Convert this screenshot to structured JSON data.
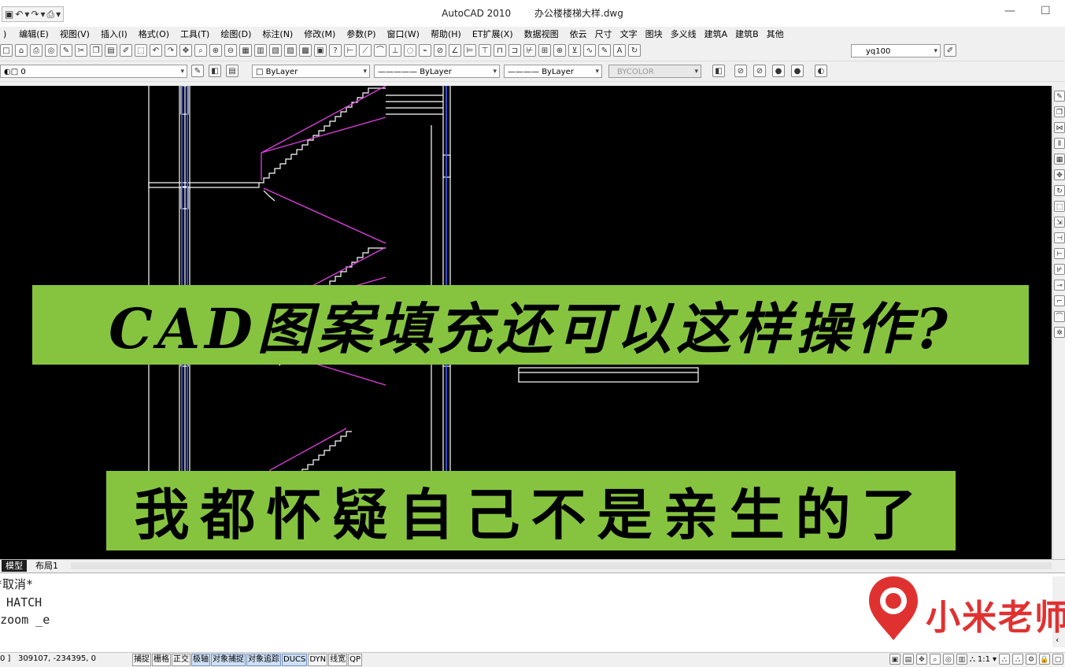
{
  "window": {
    "app_name": "AutoCAD 2010",
    "file_name": "办公楼楼梯大样.dwg"
  },
  "menu": [
    "编辑(E)",
    "视图(V)",
    "插入(I)",
    "格式(O)",
    "工具(T)",
    "绘图(D)",
    "标注(N)",
    "修改(M)",
    "参数(P)",
    "窗口(W)",
    "帮助(H)",
    "ET扩展(X)",
    "数据视图",
    "依云",
    "尺寸",
    "文字",
    "图块",
    "多义线",
    "建筑A",
    "建筑B",
    "其他"
  ],
  "toolbar1": {
    "style_combo": "yq100"
  },
  "toolbar2": {
    "layer_combo": "0",
    "color_combo": "ByLayer",
    "linetype_combo": "ByLayer",
    "lineweight_combo": "ByLayer",
    "plotstyle_combo": "BYCOLOR"
  },
  "overlay": {
    "headline": "CAD图案填充还可以这样操作?",
    "subline": "我都怀疑自己不是亲生的了"
  },
  "tabs": [
    "模型",
    "布局1"
  ],
  "command_lines": [
    "*取消*",
    "命令: HATCH",
    "命令: _.zoom _e"
  ],
  "status": {
    "coords": "309107, -234395, 0",
    "buttons": [
      "捕捉",
      "栅格",
      "正交",
      "极轴",
      "对象捕捉",
      "对象追踪",
      "DUCS",
      "DYN",
      "线宽",
      "QP"
    ],
    "active_buttons": [
      "极轴",
      "对象捕捉",
      "对象追踪",
      "DUCS"
    ],
    "scale": "1:1"
  },
  "watermark": {
    "text": "小米老师"
  },
  "colors": {
    "canvas": "#000000",
    "banner": "#86c440",
    "stair_magenta": "#e040e0",
    "wall_blue": "#4060ff",
    "logo_red": "#e03131"
  }
}
